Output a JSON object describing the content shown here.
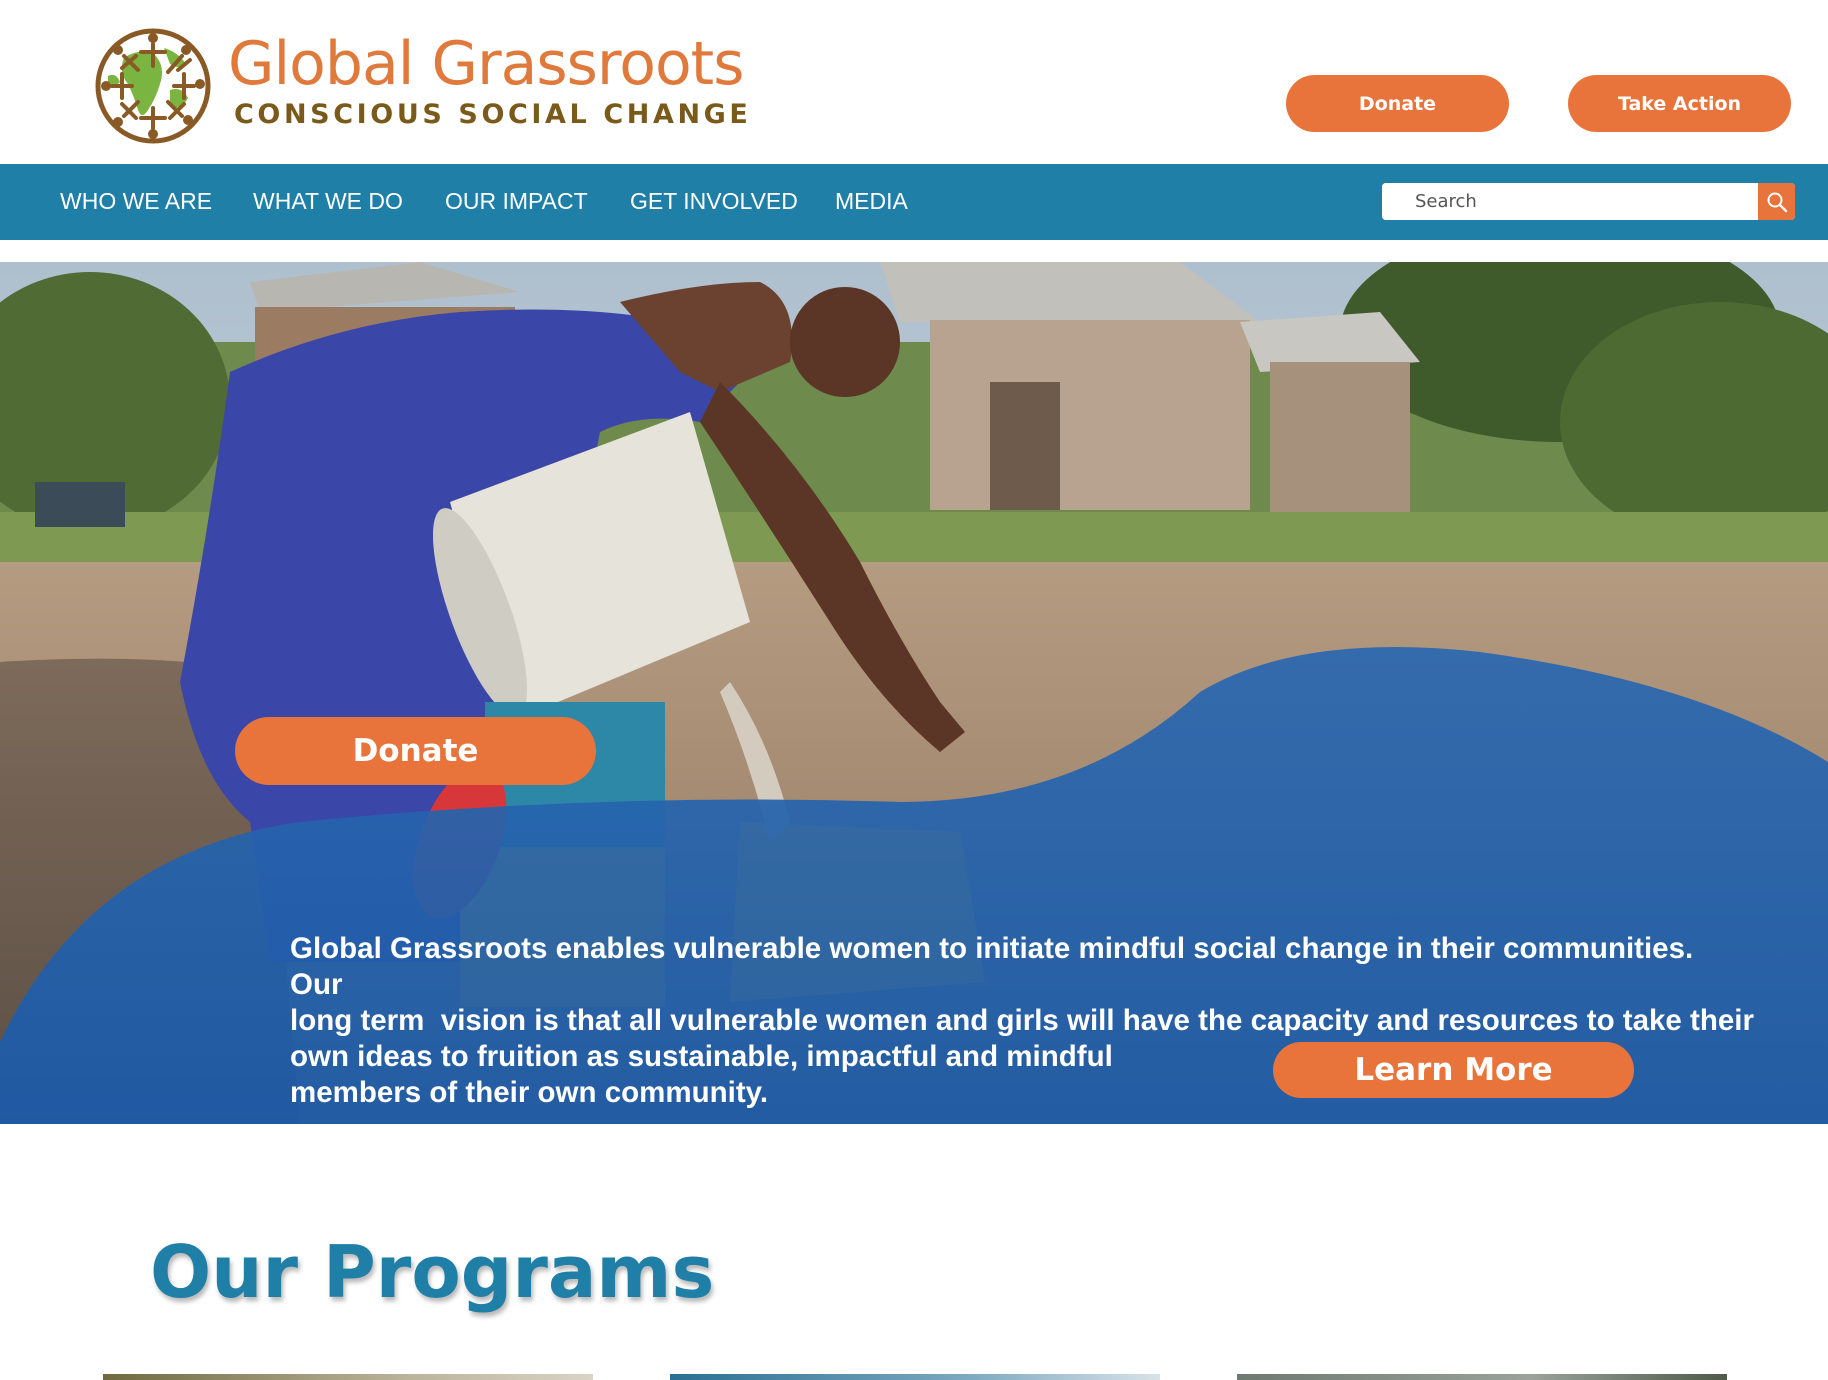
{
  "header": {
    "org_name": "Global Grassroots",
    "tagline": "CONSCIOUS SOCIAL CHANGE",
    "donate_label": "Donate",
    "take_action_label": "Take Action"
  },
  "nav": {
    "items": [
      "WHO WE ARE",
      "WHAT WE DO",
      "OUR IMPACT",
      "GET INVOLVED",
      "MEDIA"
    ],
    "search_placeholder": "Search",
    "search_icon": "magnifier-icon"
  },
  "hero": {
    "donate_label": "Donate",
    "mission_line1": "Global Grassroots enables vulnerable women to initiate mindful social change in their communities. Our",
    "mission_line2": "long term  vision is that all vulnerable women and girls will have the capacity and resources to take their",
    "mission_line3": "own ideas to fruition as sustainable, impactful and mindful",
    "mission_line4": "members of their own community.",
    "learn_more_label": "Learn More"
  },
  "programs": {
    "title": "Our Programs"
  },
  "colors": {
    "accent_orange": "#e8743b",
    "nav_blue": "#1f7fa6",
    "wave_blue": "#1c5aa8"
  }
}
